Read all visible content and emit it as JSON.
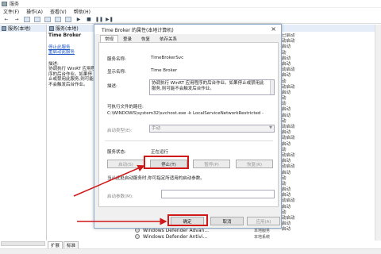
{
  "window": {
    "title": "服务"
  },
  "menu": [
    "文件(F)",
    "操作(A)",
    "查看(V)",
    "帮助(H)"
  ],
  "toolbar": {
    "buttons": [
      "back",
      "forward",
      "view",
      "view",
      "refresh",
      "help",
      "view",
      "play",
      "stop",
      "pause",
      "restart"
    ]
  },
  "tree": {
    "item": "服务(本地)"
  },
  "left_pane": {
    "service_name": "Time Broker",
    "stop_link": "停止此服务",
    "restart_link": "重启动此服务",
    "desc_heading": "描述:",
    "desc_text": "协调执行 WinRT 应用程序的后台作业。如果停止或禁用此服务,则可能不会触发后台作业。"
  },
  "background_list": [
    "已启动",
    "动启动",
    "启动",
    "动",
    "启动",
    "启动",
    "动启动",
    "启动",
    "动",
    "动启动",
    "启动",
    "动",
    "动",
    "启动",
    "启动",
    "动",
    "动启动",
    "启动",
    "动启动",
    "启动",
    "动",
    "动启动",
    "启动",
    "动启动",
    "启动",
    "动",
    "动",
    "启动",
    "启动",
    "动启动",
    "启动",
    "动",
    "动启动",
    "启动",
    "启动"
  ],
  "bottom_rows": [
    {
      "name": "Windows Defender Advan...",
      "extra": "本地服务"
    },
    {
      "name": "Windows Defender Antivi...",
      "extra": "本地系统"
    }
  ],
  "status_tabs": [
    "扩展",
    "标准"
  ],
  "dialog": {
    "title": "Time Broker 的属性(本地计算机)",
    "close": "×",
    "tabs": [
      "常规",
      "登录",
      "恢复",
      "依存关系"
    ],
    "service_name_label": "服务名称:",
    "service_name_value": "TimeBrokerSvc",
    "display_name_label": "显示名称:",
    "display_name_value": "Time Broker",
    "description_label": "描述:",
    "description_value": "协调执行 WinRT 应用程序的后台作业。如果停止或禁用此服务,则可能不会触发后台作业。",
    "exe_path_label": "可执行文件的路径:",
    "exe_path_value": "C:\\WINDOWS\\system32\\svchost.exe -k LocalServiceNetworkRestricted -",
    "startup_type_label": "启动类型(E):",
    "startup_type_value": "手动",
    "status_label": "服务状态:",
    "status_value": "正在运行",
    "buttons": {
      "start": "启动(S)",
      "stop": "停止(T)",
      "pause": "暂停(P)",
      "resume": "恢复(R)"
    },
    "hint": "当从此处启动服务时,你可指定所适用的启动参数。",
    "params_label": "启动参数(M):",
    "footer": {
      "ok": "确定",
      "cancel": "取消",
      "apply": "应用(A)"
    }
  },
  "colors": {
    "highlight": "#d01818",
    "link": "#1a56c4",
    "accent": "#8aa8c8"
  }
}
